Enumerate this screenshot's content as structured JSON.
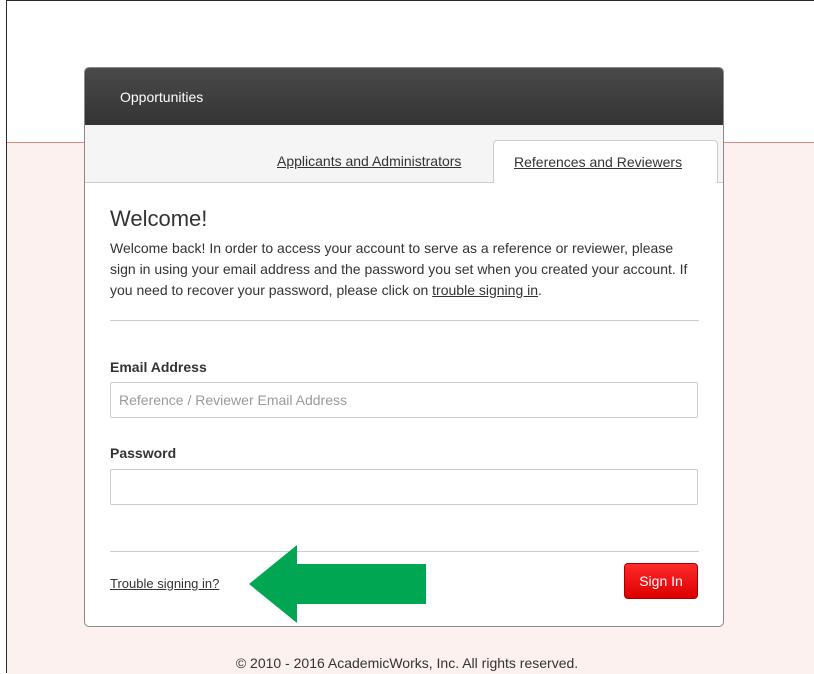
{
  "header": {
    "title": "Opportunities"
  },
  "tabs": [
    {
      "label": "Applicants and Administrators",
      "active": false
    },
    {
      "label": "References and Reviewers",
      "active": true
    }
  ],
  "main": {
    "heading": "Welcome!",
    "intro_text": "Welcome back! In order to access your account to serve as a reference or reviewer, please sign in using your email address and the password you set when you created your account. If you need to recover your password, please click on ",
    "intro_link": "trouble signing in",
    "intro_end": "."
  },
  "form": {
    "email_label": "Email Address",
    "email_placeholder": "Reference / Reviewer Email Address",
    "email_value": "",
    "password_label": "Password",
    "password_value": ""
  },
  "actions": {
    "trouble_link": "Trouble signing in?",
    "signin_label": "Sign In"
  },
  "footer": {
    "copyright": "© 2010 - 2016 AcademicWorks, Inc. All rights reserved."
  },
  "annotation": {
    "arrow_color": "#00a651",
    "arrow_direction": "left"
  },
  "colors": {
    "accent": "#e60000",
    "header_bg": "#3d3d3d",
    "page_band": "#fcf1ef"
  }
}
